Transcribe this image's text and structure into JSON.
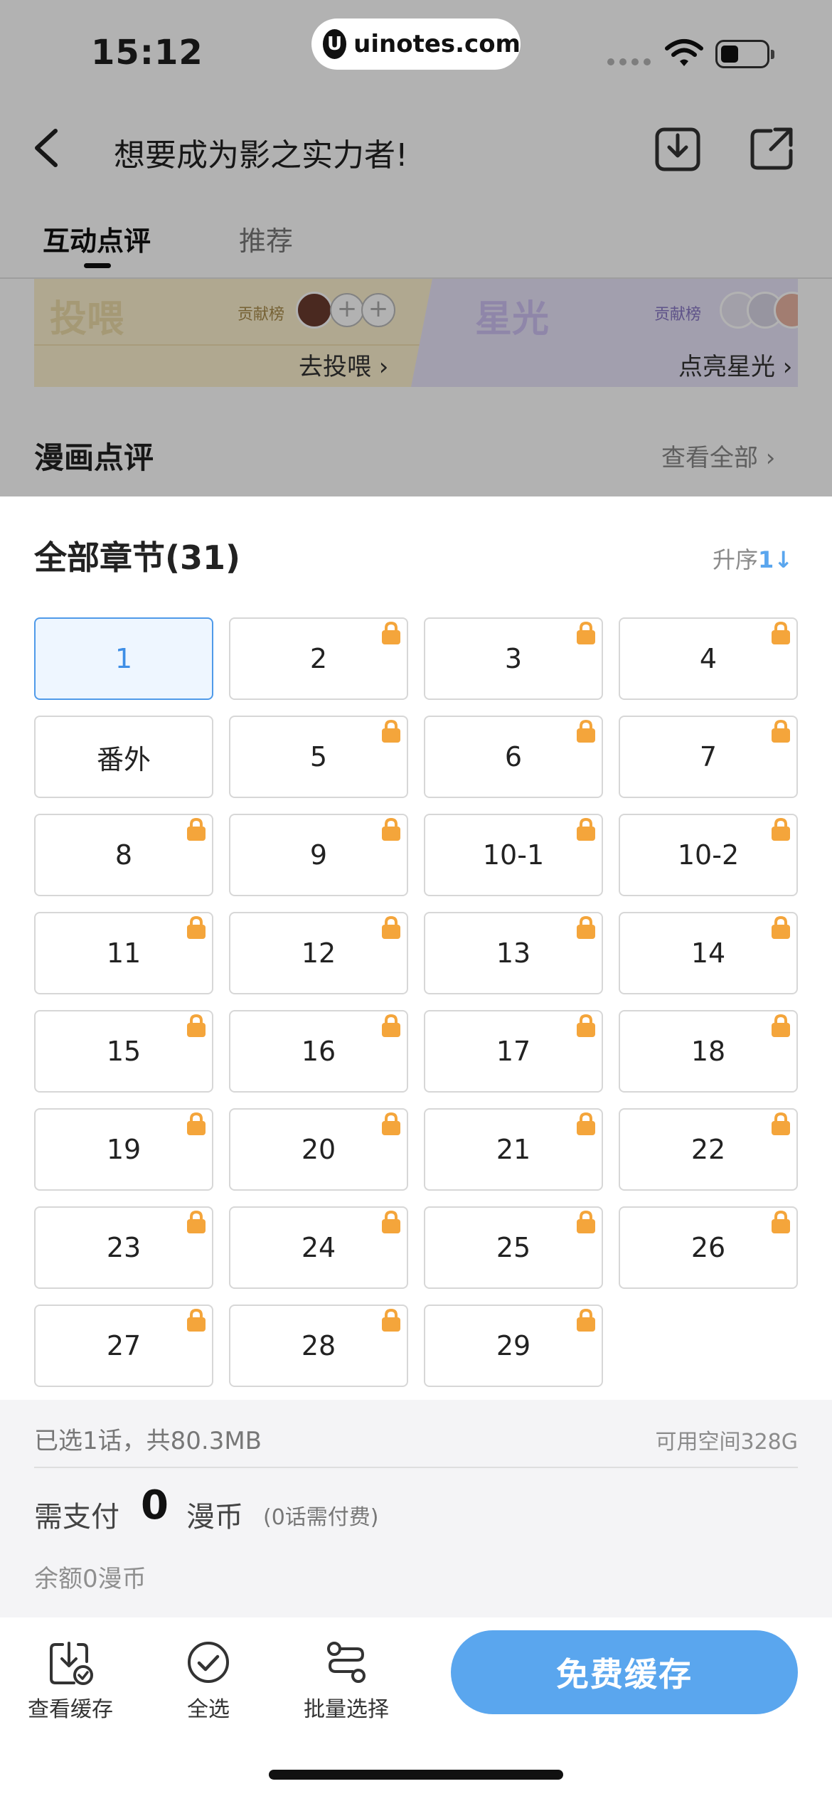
{
  "status": {
    "time": "15:12",
    "watermark": "uinotes.com",
    "watermark_logo": "U"
  },
  "nav": {
    "title": "想要成为影之实力者!",
    "icons": [
      "back-icon",
      "download-icon",
      "share-icon"
    ]
  },
  "tabs": [
    {
      "label": "互动点评",
      "active": true
    },
    {
      "label": "推荐",
      "active": false
    }
  ],
  "cards": {
    "feed": {
      "title": "投喂",
      "rank": "贡献榜",
      "plus": "+",
      "cta": "去投喂 ›"
    },
    "star": {
      "title": "星光",
      "rank": "贡献榜",
      "cta": "点亮星光 ›"
    }
  },
  "section": {
    "title": "漫画点评",
    "see_all": "查看全部 ›"
  },
  "sheet": {
    "title": "全部章节(31)",
    "sort_label": "升序",
    "sort_icon": "1↓",
    "chapters": [
      {
        "label": "1",
        "selected": true,
        "locked": false
      },
      {
        "label": "2",
        "selected": false,
        "locked": true
      },
      {
        "label": "3",
        "selected": false,
        "locked": true
      },
      {
        "label": "4",
        "selected": false,
        "locked": true
      },
      {
        "label": "番外",
        "selected": false,
        "locked": false
      },
      {
        "label": "5",
        "selected": false,
        "locked": true
      },
      {
        "label": "6",
        "selected": false,
        "locked": true
      },
      {
        "label": "7",
        "selected": false,
        "locked": true
      },
      {
        "label": "8",
        "selected": false,
        "locked": true
      },
      {
        "label": "9",
        "selected": false,
        "locked": true
      },
      {
        "label": "10-1",
        "selected": false,
        "locked": true
      },
      {
        "label": "10-2",
        "selected": false,
        "locked": true
      },
      {
        "label": "11",
        "selected": false,
        "locked": true
      },
      {
        "label": "12",
        "selected": false,
        "locked": true
      },
      {
        "label": "13",
        "selected": false,
        "locked": true
      },
      {
        "label": "14",
        "selected": false,
        "locked": true
      },
      {
        "label": "15",
        "selected": false,
        "locked": true
      },
      {
        "label": "16",
        "selected": false,
        "locked": true
      },
      {
        "label": "17",
        "selected": false,
        "locked": true
      },
      {
        "label": "18",
        "selected": false,
        "locked": true
      },
      {
        "label": "19",
        "selected": false,
        "locked": true
      },
      {
        "label": "20",
        "selected": false,
        "locked": true
      },
      {
        "label": "21",
        "selected": false,
        "locked": true
      },
      {
        "label": "22",
        "selected": false,
        "locked": true
      },
      {
        "label": "23",
        "selected": false,
        "locked": true
      },
      {
        "label": "24",
        "selected": false,
        "locked": true
      },
      {
        "label": "25",
        "selected": false,
        "locked": true
      },
      {
        "label": "26",
        "selected": false,
        "locked": true
      },
      {
        "label": "27",
        "selected": false,
        "locked": true
      },
      {
        "label": "28",
        "selected": false,
        "locked": true
      },
      {
        "label": "29",
        "selected": false,
        "locked": true
      }
    ],
    "selected_info": "已选1话，共80.3MB",
    "available_space": "可用空间328G",
    "pay_label": "需支付",
    "pay_amount": "0",
    "pay_unit": "漫币",
    "pay_note": "(0话需付费)",
    "balance": "余额0漫币"
  },
  "actions": [
    {
      "label": "查看缓存",
      "icon": "cache-download-icon"
    },
    {
      "label": "全选",
      "icon": "check-circle-icon"
    },
    {
      "label": "批量选择",
      "icon": "batch-select-icon"
    }
  ],
  "primary_button": "免费缓存",
  "colors": {
    "accent": "#5aa6ee",
    "lock": "#f4a53b",
    "selected_border": "#4f9ae9"
  }
}
